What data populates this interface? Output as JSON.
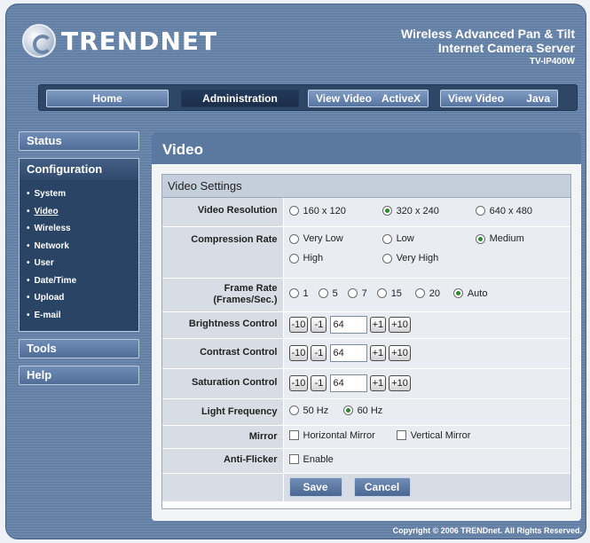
{
  "header": {
    "brand": "TRENDNET",
    "product_line1": "Wireless Advanced Pan & Tilt",
    "product_line2": "Internet Camera Server",
    "model": "TV-IP400W"
  },
  "nav": {
    "home": "Home",
    "administration": "Administration",
    "view_video_activex_a": "View Video",
    "view_video_activex_b": "ActiveX",
    "view_video_java_a": "View Video",
    "view_video_java_b": "Java"
  },
  "sidebar": {
    "status": "Status",
    "configuration": "Configuration",
    "items": [
      "System",
      "Video",
      "Wireless",
      "Network",
      "User",
      "Date/Time",
      "Upload",
      "E-mail"
    ],
    "tools": "Tools",
    "help": "Help"
  },
  "main": {
    "title": "Video",
    "section": "Video Settings",
    "resolution": {
      "label": "Video Resolution",
      "options": [
        "160 x 120",
        "320 x 240",
        "640 x 480"
      ],
      "selected": "320 x 240"
    },
    "compression": {
      "label": "Compression Rate",
      "options": [
        "Very Low",
        "Low",
        "Medium",
        "High",
        "Very High"
      ],
      "selected": "Medium"
    },
    "framerate": {
      "label1": "Frame Rate",
      "label2": "(Frames/Sec.)",
      "options": [
        "1",
        "5",
        "7",
        "15",
        "20",
        "Auto"
      ],
      "selected": "Auto"
    },
    "brightness": {
      "label": "Brightness Control",
      "value": "64"
    },
    "contrast": {
      "label": "Contrast Control",
      "value": "64"
    },
    "saturation": {
      "label": "Saturation Control",
      "value": "64"
    },
    "stepper": {
      "m10": "-10",
      "m1": "-1",
      "p1": "+1",
      "p10": "+10"
    },
    "frequency": {
      "label": "Light Frequency",
      "options": [
        "50 Hz",
        "60 Hz"
      ],
      "selected": "60 Hz"
    },
    "mirror": {
      "label": "Mirror",
      "horizontal": "Horizontal Mirror",
      "vertical": "Vertical Mirror"
    },
    "antiflicker": {
      "label": "Anti-Flicker",
      "enable": "Enable"
    },
    "save": "Save",
    "cancel": "Cancel"
  },
  "footer": {
    "copyright": "Copyright © 2006 TRENDnet. All Rights Reserved."
  }
}
